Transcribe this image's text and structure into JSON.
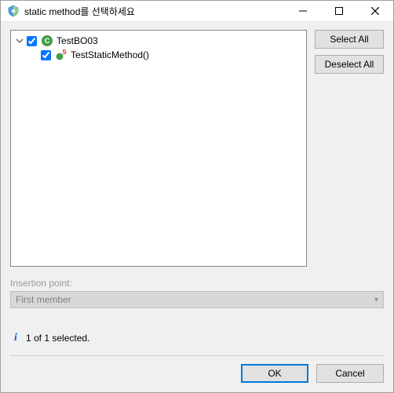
{
  "window": {
    "title": "static method를 선택하세요"
  },
  "buttons": {
    "select_all": "Select All",
    "deselect_all": "Deselect All",
    "ok": "OK",
    "cancel": "Cancel"
  },
  "tree": {
    "root": {
      "label": "TestBO03",
      "checked": true,
      "expanded": true
    },
    "child": {
      "label": "TestStaticMethod()",
      "checked": true
    }
  },
  "insertion": {
    "label": "Insertion point:",
    "value": "First member"
  },
  "status": {
    "text": "1 of 1 selected."
  },
  "icons": {
    "chevron_down": "▾"
  }
}
